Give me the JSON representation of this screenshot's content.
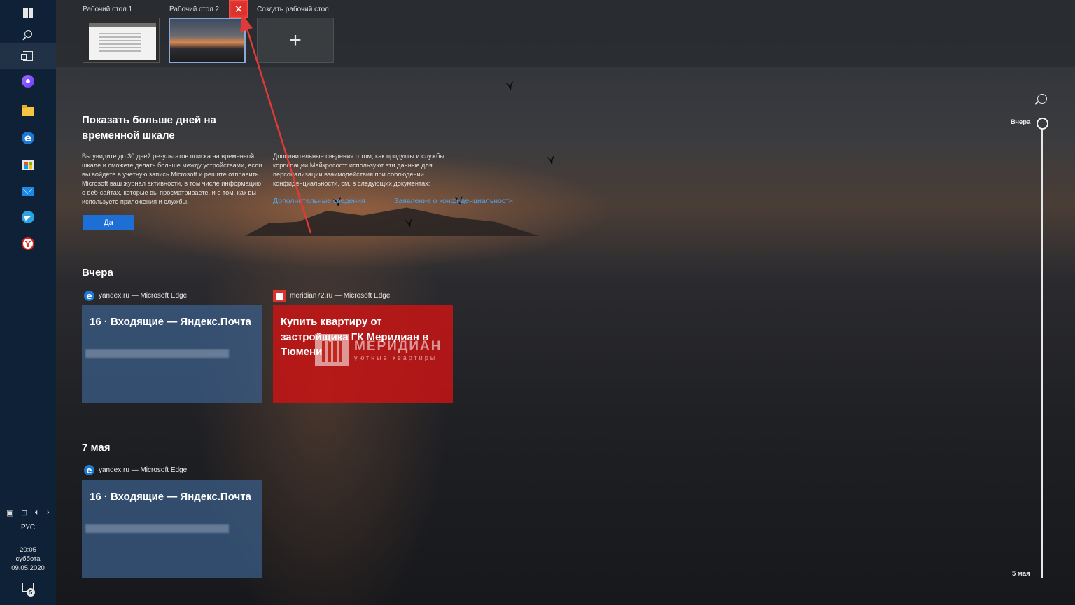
{
  "desktops": {
    "items": [
      {
        "label": "Рабочий стол 1"
      },
      {
        "label": "Рабочий стол 2"
      }
    ],
    "new_label": "Создать рабочий стол",
    "close_glyph": "✕",
    "plus_glyph": "+"
  },
  "promo": {
    "title": "Показать больше дней на временной шкале",
    "text_left": "Вы увидите до 30 дней результатов поиска на временной шкале и сможете делать больше между устройствами, если вы войдете в учетную запись Microsoft и решите отправить Microsoft ваш журнал активности, в том числе информацию о веб-сайтах, которые вы просматриваете, и о том, как вы используете приложения и службы.",
    "text_right": "Дополнительные сведения о том, как продукты и службы корпорации Майкрософт используют эти данные для персонализации взаимодействия при соблюдении конфиденциальности, см. в следующих документах:",
    "link_more": "Дополнительные сведения",
    "link_privacy": "Заявление о конфиденциальности",
    "yes_button": "Да"
  },
  "sections": [
    {
      "title": "Вчера",
      "cards": [
        {
          "source": "yandex.ru — Microsoft Edge",
          "title": "16 · Входящие — Яндекс.Почта",
          "style": "blue",
          "icon": "edge-icon"
        },
        {
          "source": "meridian72.ru — Microsoft Edge",
          "title": "Купить квартиру от застройщика ГК Меридиан в Тюмени",
          "style": "red",
          "icon": "meridian-icon",
          "logo_name": "МЕРИДИАН",
          "logo_sub": "уютные квартиры"
        }
      ]
    },
    {
      "title": "7 мая",
      "cards": [
        {
          "source": "yandex.ru — Microsoft Edge",
          "title": "16 · Входящие — Яндекс.Почта",
          "style": "blue",
          "icon": "edge-icon"
        }
      ]
    }
  ],
  "scrubber": {
    "top_label": "Вчера",
    "bottom_label": "5 мая"
  },
  "taskbar": {
    "icons": [
      "windows-icon",
      "search-icon",
      "task-view-icon",
      "alice-icon",
      "file-explorer-icon",
      "edge-icon",
      "store-icon",
      "mail-icon",
      "telegram-icon",
      "yandex-browser-icon"
    ],
    "tray_chevron": "›",
    "language": "РУС",
    "time": "20:05",
    "weekday": "суббота",
    "date": "09.05.2020",
    "notification_count": "5"
  },
  "colors": {
    "accent": "#1d6fd6",
    "close": "#e0302b",
    "annotation_arrow": "#e03a36",
    "taskbar": "#0f2137"
  }
}
